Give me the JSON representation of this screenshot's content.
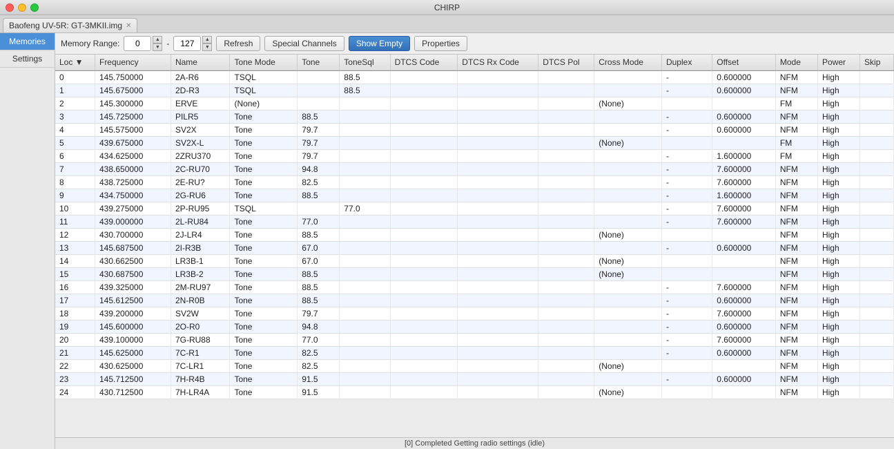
{
  "window": {
    "title": "CHIRP"
  },
  "tab": {
    "label": "Baofeng UV-5R: GT-3MKII.img"
  },
  "sidebar": {
    "items": [
      {
        "id": "memories",
        "label": "Memories",
        "active": true
      },
      {
        "id": "settings",
        "label": "Settings",
        "active": false
      }
    ]
  },
  "toolbar": {
    "memory_range_label": "Memory Range:",
    "range_from": "0",
    "range_to": "127",
    "refresh_label": "Refresh",
    "special_channels_label": "Special Channels",
    "show_empty_label": "Show Empty",
    "properties_label": "Properties"
  },
  "table": {
    "columns": [
      "Loc",
      "Frequency",
      "Name",
      "Tone Mode",
      "Tone",
      "ToneSql",
      "DTCS Code",
      "DTCS Rx Code",
      "DTCS Pol",
      "Cross Mode",
      "Duplex",
      "Offset",
      "Mode",
      "Power",
      "Skip"
    ],
    "rows": [
      {
        "loc": "0",
        "freq": "145.750000",
        "name": "2A-R6",
        "tonemode": "TSQL",
        "tone": "",
        "tonesql": "88.5",
        "dtcscode": "",
        "dtcsrx": "",
        "dtcspol": "",
        "crossmode": "",
        "duplex": "-",
        "offset": "0.600000",
        "mode": "NFM",
        "power": "High",
        "skip": ""
      },
      {
        "loc": "1",
        "freq": "145.675000",
        "name": "2D-R3",
        "tonemode": "TSQL",
        "tone": "",
        "tonesql": "88.5",
        "dtcscode": "",
        "dtcsrx": "",
        "dtcspol": "",
        "crossmode": "",
        "duplex": "-",
        "offset": "0.600000",
        "mode": "NFM",
        "power": "High",
        "skip": ""
      },
      {
        "loc": "2",
        "freq": "145.300000",
        "name": "ERVE",
        "tonemode": "(None)",
        "tone": "",
        "tonesql": "",
        "dtcscode": "",
        "dtcsrx": "",
        "dtcspol": "",
        "crossmode": "(None)",
        "duplex": "",
        "offset": "",
        "mode": "FM",
        "power": "High",
        "skip": ""
      },
      {
        "loc": "3",
        "freq": "145.725000",
        "name": "PILR5",
        "tonemode": "Tone",
        "tone": "88.5",
        "tonesql": "",
        "dtcscode": "",
        "dtcsrx": "",
        "dtcspol": "",
        "crossmode": "",
        "duplex": "-",
        "offset": "0.600000",
        "mode": "NFM",
        "power": "High",
        "skip": ""
      },
      {
        "loc": "4",
        "freq": "145.575000",
        "name": "SV2X",
        "tonemode": "Tone",
        "tone": "79.7",
        "tonesql": "",
        "dtcscode": "",
        "dtcsrx": "",
        "dtcspol": "",
        "crossmode": "",
        "duplex": "-",
        "offset": "0.600000",
        "mode": "NFM",
        "power": "High",
        "skip": ""
      },
      {
        "loc": "5",
        "freq": "439.675000",
        "name": "SV2X-L",
        "tonemode": "Tone",
        "tone": "79.7",
        "tonesql": "",
        "dtcscode": "",
        "dtcsrx": "",
        "dtcspol": "",
        "crossmode": "(None)",
        "duplex": "",
        "offset": "",
        "mode": "FM",
        "power": "High",
        "skip": ""
      },
      {
        "loc": "6",
        "freq": "434.625000",
        "name": "2ZRU370",
        "tonemode": "Tone",
        "tone": "79.7",
        "tonesql": "",
        "dtcscode": "",
        "dtcsrx": "",
        "dtcspol": "",
        "crossmode": "",
        "duplex": "-",
        "offset": "1.600000",
        "mode": "FM",
        "power": "High",
        "skip": ""
      },
      {
        "loc": "7",
        "freq": "438.650000",
        "name": "2C-RU70",
        "tonemode": "Tone",
        "tone": "94.8",
        "tonesql": "",
        "dtcscode": "",
        "dtcsrx": "",
        "dtcspol": "",
        "crossmode": "",
        "duplex": "-",
        "offset": "7.600000",
        "mode": "NFM",
        "power": "High",
        "skip": ""
      },
      {
        "loc": "8",
        "freq": "438.725000",
        "name": "2E-RU?",
        "tonemode": "Tone",
        "tone": "82.5",
        "tonesql": "",
        "dtcscode": "",
        "dtcsrx": "",
        "dtcspol": "",
        "crossmode": "",
        "duplex": "-",
        "offset": "7.600000",
        "mode": "NFM",
        "power": "High",
        "skip": ""
      },
      {
        "loc": "9",
        "freq": "434.750000",
        "name": "2G-RU6",
        "tonemode": "Tone",
        "tone": "88.5",
        "tonesql": "",
        "dtcscode": "",
        "dtcsrx": "",
        "dtcspol": "",
        "crossmode": "",
        "duplex": "-",
        "offset": "1.600000",
        "mode": "NFM",
        "power": "High",
        "skip": ""
      },
      {
        "loc": "10",
        "freq": "439.275000",
        "name": "2P-RU95",
        "tonemode": "TSQL",
        "tone": "",
        "tonesql": "77.0",
        "dtcscode": "",
        "dtcsrx": "",
        "dtcspol": "",
        "crossmode": "",
        "duplex": "-",
        "offset": "7.600000",
        "mode": "NFM",
        "power": "High",
        "skip": ""
      },
      {
        "loc": "11",
        "freq": "439.000000",
        "name": "2L-RU84",
        "tonemode": "Tone",
        "tone": "77.0",
        "tonesql": "",
        "dtcscode": "",
        "dtcsrx": "",
        "dtcspol": "",
        "crossmode": "",
        "duplex": "-",
        "offset": "7.600000",
        "mode": "NFM",
        "power": "High",
        "skip": ""
      },
      {
        "loc": "12",
        "freq": "430.700000",
        "name": "2J-LR4",
        "tonemode": "Tone",
        "tone": "88.5",
        "tonesql": "",
        "dtcscode": "",
        "dtcsrx": "",
        "dtcspol": "",
        "crossmode": "(None)",
        "duplex": "",
        "offset": "",
        "mode": "NFM",
        "power": "High",
        "skip": ""
      },
      {
        "loc": "13",
        "freq": "145.687500",
        "name": "2I-R3B",
        "tonemode": "Tone",
        "tone": "67.0",
        "tonesql": "",
        "dtcscode": "",
        "dtcsrx": "",
        "dtcspol": "",
        "crossmode": "",
        "duplex": "-",
        "offset": "0.600000",
        "mode": "NFM",
        "power": "High",
        "skip": ""
      },
      {
        "loc": "14",
        "freq": "430.662500",
        "name": "LR3B-1",
        "tonemode": "Tone",
        "tone": "67.0",
        "tonesql": "",
        "dtcscode": "",
        "dtcsrx": "",
        "dtcspol": "",
        "crossmode": "(None)",
        "duplex": "",
        "offset": "",
        "mode": "NFM",
        "power": "High",
        "skip": ""
      },
      {
        "loc": "15",
        "freq": "430.687500",
        "name": "LR3B-2",
        "tonemode": "Tone",
        "tone": "88.5",
        "tonesql": "",
        "dtcscode": "",
        "dtcsrx": "",
        "dtcspol": "",
        "crossmode": "(None)",
        "duplex": "",
        "offset": "",
        "mode": "NFM",
        "power": "High",
        "skip": ""
      },
      {
        "loc": "16",
        "freq": "439.325000",
        "name": "2M-RU97",
        "tonemode": "Tone",
        "tone": "88.5",
        "tonesql": "",
        "dtcscode": "",
        "dtcsrx": "",
        "dtcspol": "",
        "crossmode": "",
        "duplex": "-",
        "offset": "7.600000",
        "mode": "NFM",
        "power": "High",
        "skip": ""
      },
      {
        "loc": "17",
        "freq": "145.612500",
        "name": "2N-R0B",
        "tonemode": "Tone",
        "tone": "88.5",
        "tonesql": "",
        "dtcscode": "",
        "dtcsrx": "",
        "dtcspol": "",
        "crossmode": "",
        "duplex": "-",
        "offset": "0.600000",
        "mode": "NFM",
        "power": "High",
        "skip": ""
      },
      {
        "loc": "18",
        "freq": "439.200000",
        "name": "SV2W",
        "tonemode": "Tone",
        "tone": "79.7",
        "tonesql": "",
        "dtcscode": "",
        "dtcsrx": "",
        "dtcspol": "",
        "crossmode": "",
        "duplex": "-",
        "offset": "7.600000",
        "mode": "NFM",
        "power": "High",
        "skip": ""
      },
      {
        "loc": "19",
        "freq": "145.600000",
        "name": "2O-R0",
        "tonemode": "Tone",
        "tone": "94.8",
        "tonesql": "",
        "dtcscode": "",
        "dtcsrx": "",
        "dtcspol": "",
        "crossmode": "",
        "duplex": "-",
        "offset": "0.600000",
        "mode": "NFM",
        "power": "High",
        "skip": ""
      },
      {
        "loc": "20",
        "freq": "439.100000",
        "name": "7G-RU88",
        "tonemode": "Tone",
        "tone": "77.0",
        "tonesql": "",
        "dtcscode": "",
        "dtcsrx": "",
        "dtcspol": "",
        "crossmode": "",
        "duplex": "-",
        "offset": "7.600000",
        "mode": "NFM",
        "power": "High",
        "skip": ""
      },
      {
        "loc": "21",
        "freq": "145.625000",
        "name": "7C-R1",
        "tonemode": "Tone",
        "tone": "82.5",
        "tonesql": "",
        "dtcscode": "",
        "dtcsrx": "",
        "dtcspol": "",
        "crossmode": "",
        "duplex": "-",
        "offset": "0.600000",
        "mode": "NFM",
        "power": "High",
        "skip": ""
      },
      {
        "loc": "22",
        "freq": "430.625000",
        "name": "7C-LR1",
        "tonemode": "Tone",
        "tone": "82.5",
        "tonesql": "",
        "dtcscode": "",
        "dtcsrx": "",
        "dtcspol": "",
        "crossmode": "(None)",
        "duplex": "",
        "offset": "",
        "mode": "NFM",
        "power": "High",
        "skip": ""
      },
      {
        "loc": "23",
        "freq": "145.712500",
        "name": "7H-R4B",
        "tonemode": "Tone",
        "tone": "91.5",
        "tonesql": "",
        "dtcscode": "",
        "dtcsrx": "",
        "dtcspol": "",
        "crossmode": "",
        "duplex": "-",
        "offset": "0.600000",
        "mode": "NFM",
        "power": "High",
        "skip": ""
      },
      {
        "loc": "24",
        "freq": "430.712500",
        "name": "7H-LR4A",
        "tonemode": "Tone",
        "tone": "91.5",
        "tonesql": "",
        "dtcscode": "",
        "dtcsrx": "",
        "dtcspol": "",
        "crossmode": "(None)",
        "duplex": "",
        "offset": "",
        "mode": "NFM",
        "power": "High",
        "skip": ""
      }
    ]
  },
  "status_bar": {
    "message": "[0] Completed Getting radio settings (idle)"
  }
}
